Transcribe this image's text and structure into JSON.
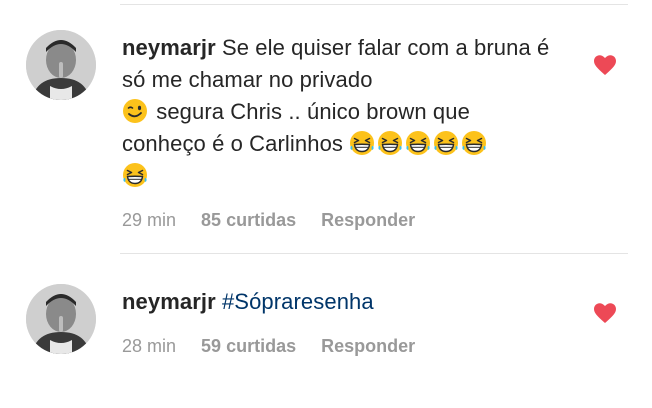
{
  "colors": {
    "text": "#262626",
    "meta": "#999999",
    "hashtag": "#003569",
    "heart": "#ed4956",
    "divider": "#e4e4e4"
  },
  "comments": [
    {
      "username": "neymarjr",
      "text_part1": "Se ele quiser falar com a bruna é só me chamar no privado",
      "emoji_1": "winking-face-emoji",
      "text_part2": "segura Chris .. único brown que conheço é o Carlinhos",
      "trailing_emoji": "grinning-squinting-face-emoji",
      "trailing_emoji_count": 6,
      "time": "29 min",
      "likes": "85 curtidas",
      "reply": "Responder",
      "liked": true
    },
    {
      "username": "neymarjr",
      "hashtag": "#Sópraresenha",
      "time": "28 min",
      "likes": "59 curtidas",
      "reply": "Responder",
      "liked": true
    }
  ]
}
